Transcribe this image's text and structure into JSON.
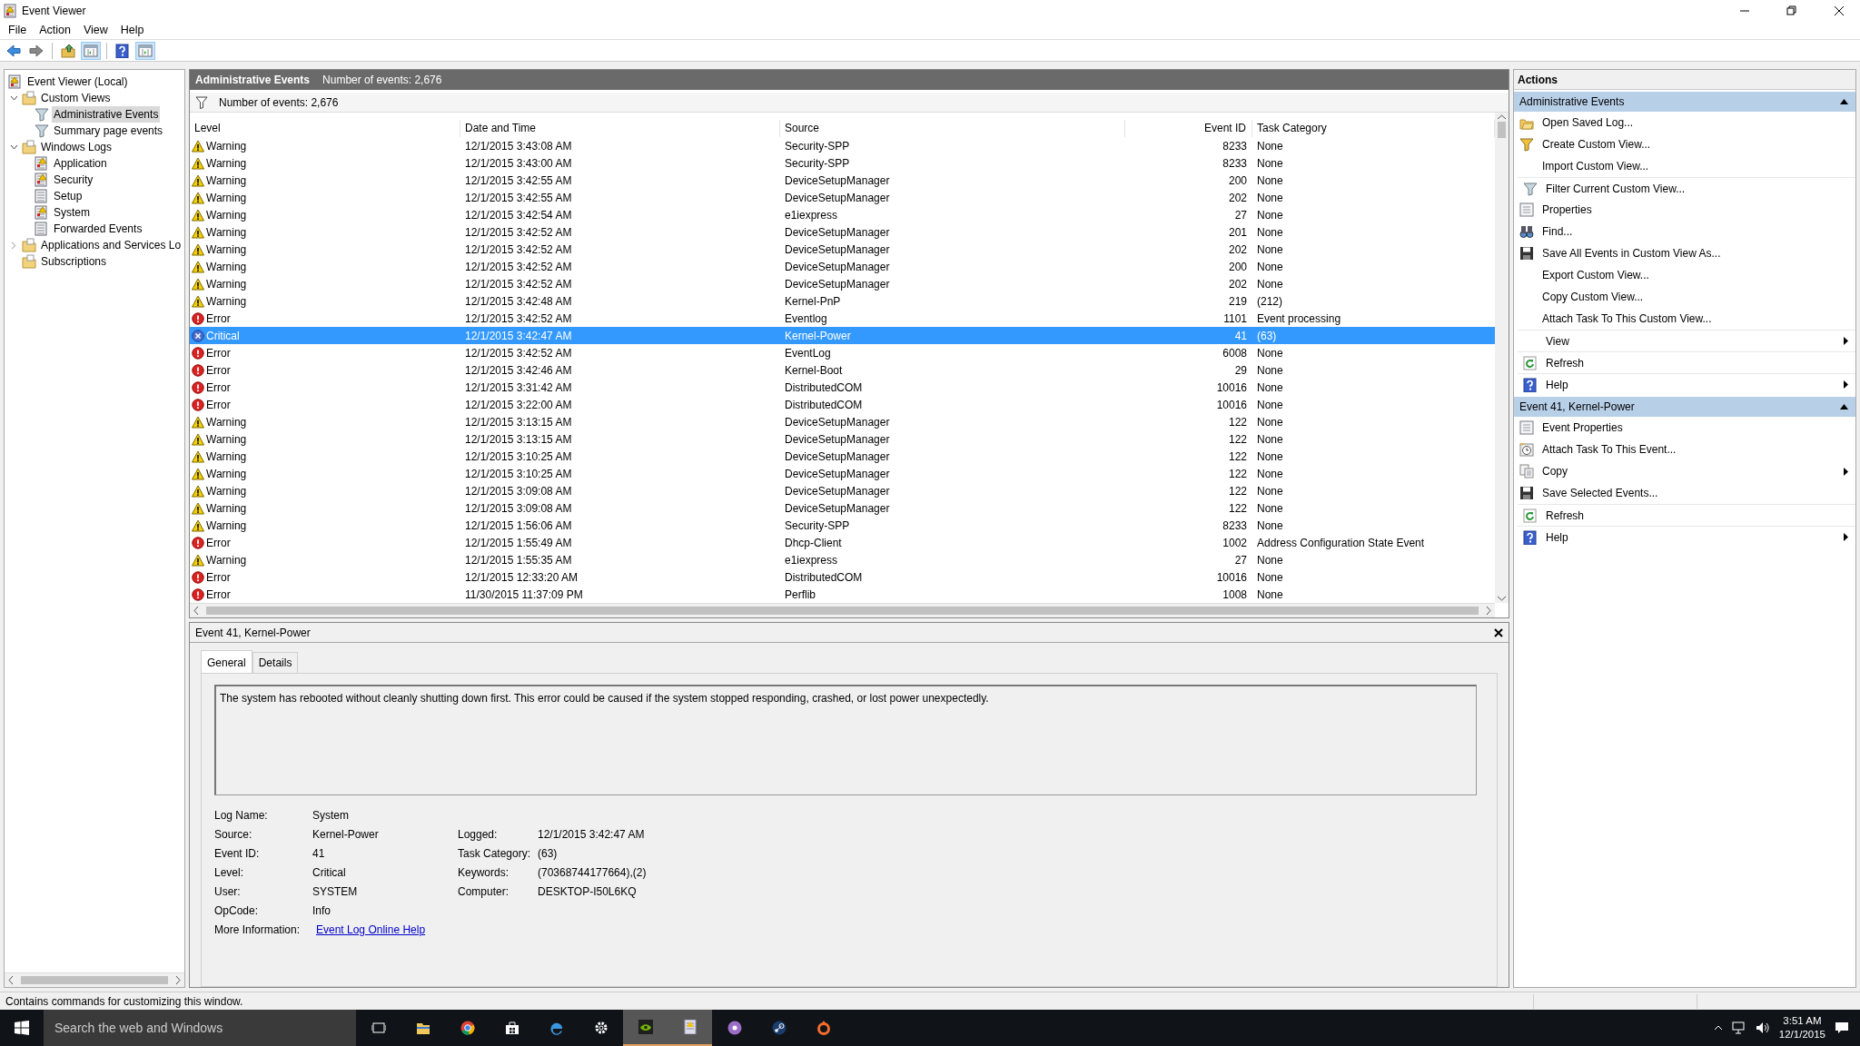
{
  "window": {
    "title": "Event Viewer"
  },
  "menu": [
    "File",
    "Action",
    "View",
    "Help"
  ],
  "toolbar": [
    {
      "kind": "back",
      "selected": false
    },
    {
      "kind": "forward",
      "selected": false
    },
    {
      "kind": "up",
      "selected": false
    },
    {
      "kind": "pane-left",
      "selected": true
    },
    {
      "kind": "help",
      "selected": false
    },
    {
      "kind": "pane-right",
      "selected": true
    }
  ],
  "tree": [
    {
      "label": "Event Viewer (Local)",
      "kind": "root",
      "selected": false,
      "children": [
        {
          "label": "Custom Views",
          "kind": "folder",
          "expanded": true,
          "selected": false,
          "children": [
            {
              "label": "Administrative Events",
              "kind": "filter",
              "selected": true
            },
            {
              "label": "Summary page events",
              "kind": "filter",
              "selected": false
            }
          ]
        },
        {
          "label": "Windows Logs",
          "kind": "folder",
          "expanded": true,
          "selected": false,
          "children": [
            {
              "label": "Application",
              "kind": "log",
              "selected": false
            },
            {
              "label": "Security",
              "kind": "log",
              "selected": false
            },
            {
              "label": "Setup",
              "kind": "log-plain",
              "selected": false
            },
            {
              "label": "System",
              "kind": "log",
              "selected": false
            },
            {
              "label": "Forwarded Events",
              "kind": "log-plain",
              "selected": false
            }
          ]
        },
        {
          "label": "Applications and Services Lo",
          "kind": "folder",
          "expanded": false,
          "selected": false
        },
        {
          "label": "Subscriptions",
          "kind": "folder",
          "selected": false
        }
      ]
    }
  ],
  "view": {
    "title": "Administrative Events",
    "count": "Number of events: 2,676",
    "filter_text": "Number of events: 2,676"
  },
  "table": {
    "columns": [
      "Level",
      "Date and Time",
      "Source",
      "Event ID",
      "Task Category"
    ],
    "rows": [
      {
        "kind": "warning",
        "level": "Warning",
        "date": "12/1/2015 3:43:08 AM",
        "source": "Security-SPP",
        "event_id": "8233",
        "category": "None",
        "selected": false
      },
      {
        "kind": "warning",
        "level": "Warning",
        "date": "12/1/2015 3:43:00 AM",
        "source": "Security-SPP",
        "event_id": "8233",
        "category": "None",
        "selected": false
      },
      {
        "kind": "warning",
        "level": "Warning",
        "date": "12/1/2015 3:42:55 AM",
        "source": "DeviceSetupManager",
        "event_id": "200",
        "category": "None",
        "selected": false
      },
      {
        "kind": "warning",
        "level": "Warning",
        "date": "12/1/2015 3:42:55 AM",
        "source": "DeviceSetupManager",
        "event_id": "202",
        "category": "None",
        "selected": false
      },
      {
        "kind": "warning",
        "level": "Warning",
        "date": "12/1/2015 3:42:54 AM",
        "source": "e1iexpress",
        "event_id": "27",
        "category": "None",
        "selected": false
      },
      {
        "kind": "warning",
        "level": "Warning",
        "date": "12/1/2015 3:42:52 AM",
        "source": "DeviceSetupManager",
        "event_id": "201",
        "category": "None",
        "selected": false
      },
      {
        "kind": "warning",
        "level": "Warning",
        "date": "12/1/2015 3:42:52 AM",
        "source": "DeviceSetupManager",
        "event_id": "202",
        "category": "None",
        "selected": false
      },
      {
        "kind": "warning",
        "level": "Warning",
        "date": "12/1/2015 3:42:52 AM",
        "source": "DeviceSetupManager",
        "event_id": "200",
        "category": "None",
        "selected": false
      },
      {
        "kind": "warning",
        "level": "Warning",
        "date": "12/1/2015 3:42:52 AM",
        "source": "DeviceSetupManager",
        "event_id": "202",
        "category": "None",
        "selected": false
      },
      {
        "kind": "warning",
        "level": "Warning",
        "date": "12/1/2015 3:42:48 AM",
        "source": "Kernel-PnP",
        "event_id": "219",
        "category": "(212)",
        "selected": false
      },
      {
        "kind": "error",
        "level": "Error",
        "date": "12/1/2015 3:42:52 AM",
        "source": "Eventlog",
        "event_id": "1101",
        "category": "Event processing",
        "selected": false
      },
      {
        "kind": "critical",
        "level": "Critical",
        "date": "12/1/2015 3:42:47 AM",
        "source": "Kernel-Power",
        "event_id": "41",
        "category": "(63)",
        "selected": true
      },
      {
        "kind": "error",
        "level": "Error",
        "date": "12/1/2015 3:42:52 AM",
        "source": "EventLog",
        "event_id": "6008",
        "category": "None",
        "selected": false
      },
      {
        "kind": "error",
        "level": "Error",
        "date": "12/1/2015 3:42:46 AM",
        "source": "Kernel-Boot",
        "event_id": "29",
        "category": "None",
        "selected": false
      },
      {
        "kind": "error",
        "level": "Error",
        "date": "12/1/2015 3:31:42 AM",
        "source": "DistributedCOM",
        "event_id": "10016",
        "category": "None",
        "selected": false
      },
      {
        "kind": "error",
        "level": "Error",
        "date": "12/1/2015 3:22:00 AM",
        "source": "DistributedCOM",
        "event_id": "10016",
        "category": "None",
        "selected": false
      },
      {
        "kind": "warning",
        "level": "Warning",
        "date": "12/1/2015 3:13:15 AM",
        "source": "DeviceSetupManager",
        "event_id": "122",
        "category": "None",
        "selected": false
      },
      {
        "kind": "warning",
        "level": "Warning",
        "date": "12/1/2015 3:13:15 AM",
        "source": "DeviceSetupManager",
        "event_id": "122",
        "category": "None",
        "selected": false
      },
      {
        "kind": "warning",
        "level": "Warning",
        "date": "12/1/2015 3:10:25 AM",
        "source": "DeviceSetupManager",
        "event_id": "122",
        "category": "None",
        "selected": false
      },
      {
        "kind": "warning",
        "level": "Warning",
        "date": "12/1/2015 3:10:25 AM",
        "source": "DeviceSetupManager",
        "event_id": "122",
        "category": "None",
        "selected": false
      },
      {
        "kind": "warning",
        "level": "Warning",
        "date": "12/1/2015 3:09:08 AM",
        "source": "DeviceSetupManager",
        "event_id": "122",
        "category": "None",
        "selected": false
      },
      {
        "kind": "warning",
        "level": "Warning",
        "date": "12/1/2015 3:09:08 AM",
        "source": "DeviceSetupManager",
        "event_id": "122",
        "category": "None",
        "selected": false
      },
      {
        "kind": "warning",
        "level": "Warning",
        "date": "12/1/2015 1:56:06 AM",
        "source": "Security-SPP",
        "event_id": "8233",
        "category": "None",
        "selected": false
      },
      {
        "kind": "error",
        "level": "Error",
        "date": "12/1/2015 1:55:49 AM",
        "source": "Dhcp-Client",
        "event_id": "1002",
        "category": "Address Configuration State Event",
        "selected": false
      },
      {
        "kind": "warning",
        "level": "Warning",
        "date": "12/1/2015 1:55:35 AM",
        "source": "e1iexpress",
        "event_id": "27",
        "category": "None",
        "selected": false
      },
      {
        "kind": "error",
        "level": "Error",
        "date": "12/1/2015 12:33:20 AM",
        "source": "DistributedCOM",
        "event_id": "10016",
        "category": "None",
        "selected": false
      },
      {
        "kind": "error",
        "level": "Error",
        "date": "11/30/2015 11:37:09 PM",
        "source": "Perflib",
        "event_id": "1008",
        "category": "None",
        "selected": false
      }
    ]
  },
  "details": {
    "title": "Event 41, Kernel-Power",
    "tabs": [
      {
        "label": "General",
        "selected": true
      },
      {
        "label": "Details",
        "selected": false
      }
    ],
    "description": "The system has rebooted without cleanly shutting down first. This error could be caused if the system stopped responding, crashed, or lost power unexpectedly.",
    "fields_left": [
      {
        "label": "Log Name:",
        "value": "System"
      },
      {
        "label": "Source:",
        "value": "Kernel-Power"
      },
      {
        "label": "Event ID:",
        "value": "41"
      },
      {
        "label": "Level:",
        "value": "Critical"
      },
      {
        "label": "User:",
        "value": "SYSTEM"
      },
      {
        "label": "OpCode:",
        "value": "Info"
      },
      {
        "label": "More Information:",
        "value": "Event Log Online Help",
        "kind": "link"
      }
    ],
    "fields_right": [
      {
        "label": "Logged:",
        "value": "12/1/2015 3:42:47 AM"
      },
      {
        "label": "Task Category:",
        "value": "(63)"
      },
      {
        "label": "Keywords:",
        "value": "(70368744177664),(2)"
      },
      {
        "label": "Computer:",
        "value": "DESKTOP-I50L6KQ"
      }
    ]
  },
  "actions": {
    "title": "Actions",
    "sections": [
      {
        "title": "Administrative Events",
        "expanded": true,
        "items": [
          {
            "label": "Open Saved Log...",
            "kind": "folder"
          },
          {
            "label": "Create Custom View...",
            "kind": "filter-new"
          },
          {
            "label": "Import Custom View..."
          },
          {
            "label": "Filter Current Custom View...",
            "kind": "filter",
            "separator": true
          },
          {
            "label": "Properties",
            "kind": "properties"
          },
          {
            "label": "Find...",
            "kind": "binoculars"
          },
          {
            "label": "Save All Events in Custom View As...",
            "kind": "save"
          },
          {
            "label": "Export Custom View..."
          },
          {
            "label": "Copy Custom View..."
          },
          {
            "label": "Attach Task To This Custom View..."
          },
          {
            "label": "View",
            "submenu": true,
            "separator": true
          },
          {
            "label": "Refresh",
            "kind": "refresh",
            "separator": true
          },
          {
            "label": "Help",
            "kind": "help",
            "submenu": true,
            "separator": true
          }
        ]
      },
      {
        "title": "Event 41, Kernel-Power",
        "expanded": true,
        "items": [
          {
            "label": "Event Properties",
            "kind": "properties"
          },
          {
            "label": "Attach Task To This Event...",
            "kind": "clock"
          },
          {
            "label": "Copy",
            "kind": "copy",
            "submenu": true
          },
          {
            "label": "Save Selected Events...",
            "kind": "save"
          },
          {
            "label": "Refresh",
            "kind": "refresh",
            "separator": true
          },
          {
            "label": "Help",
            "kind": "help",
            "submenu": true,
            "separator": true
          }
        ]
      }
    ]
  },
  "status_bar": "Contains commands for customizing this window.",
  "taskbar": {
    "search_placeholder": "Search the web and Windows",
    "apps": [
      {
        "kind": "task-view",
        "selected": false
      },
      {
        "kind": "explorer",
        "selected": false
      },
      {
        "kind": "chrome",
        "selected": false
      },
      {
        "kind": "store",
        "selected": false
      },
      {
        "kind": "edge",
        "selected": false
      },
      {
        "kind": "settings",
        "selected": false
      },
      {
        "kind": "nvidia",
        "selected": true
      },
      {
        "kind": "eventvwr",
        "selected": true
      },
      {
        "kind": "disc",
        "selected": false
      },
      {
        "kind": "steam",
        "selected": false
      },
      {
        "kind": "origin",
        "selected": false
      }
    ],
    "time": "3:51 AM",
    "date": "12/1/2015"
  }
}
